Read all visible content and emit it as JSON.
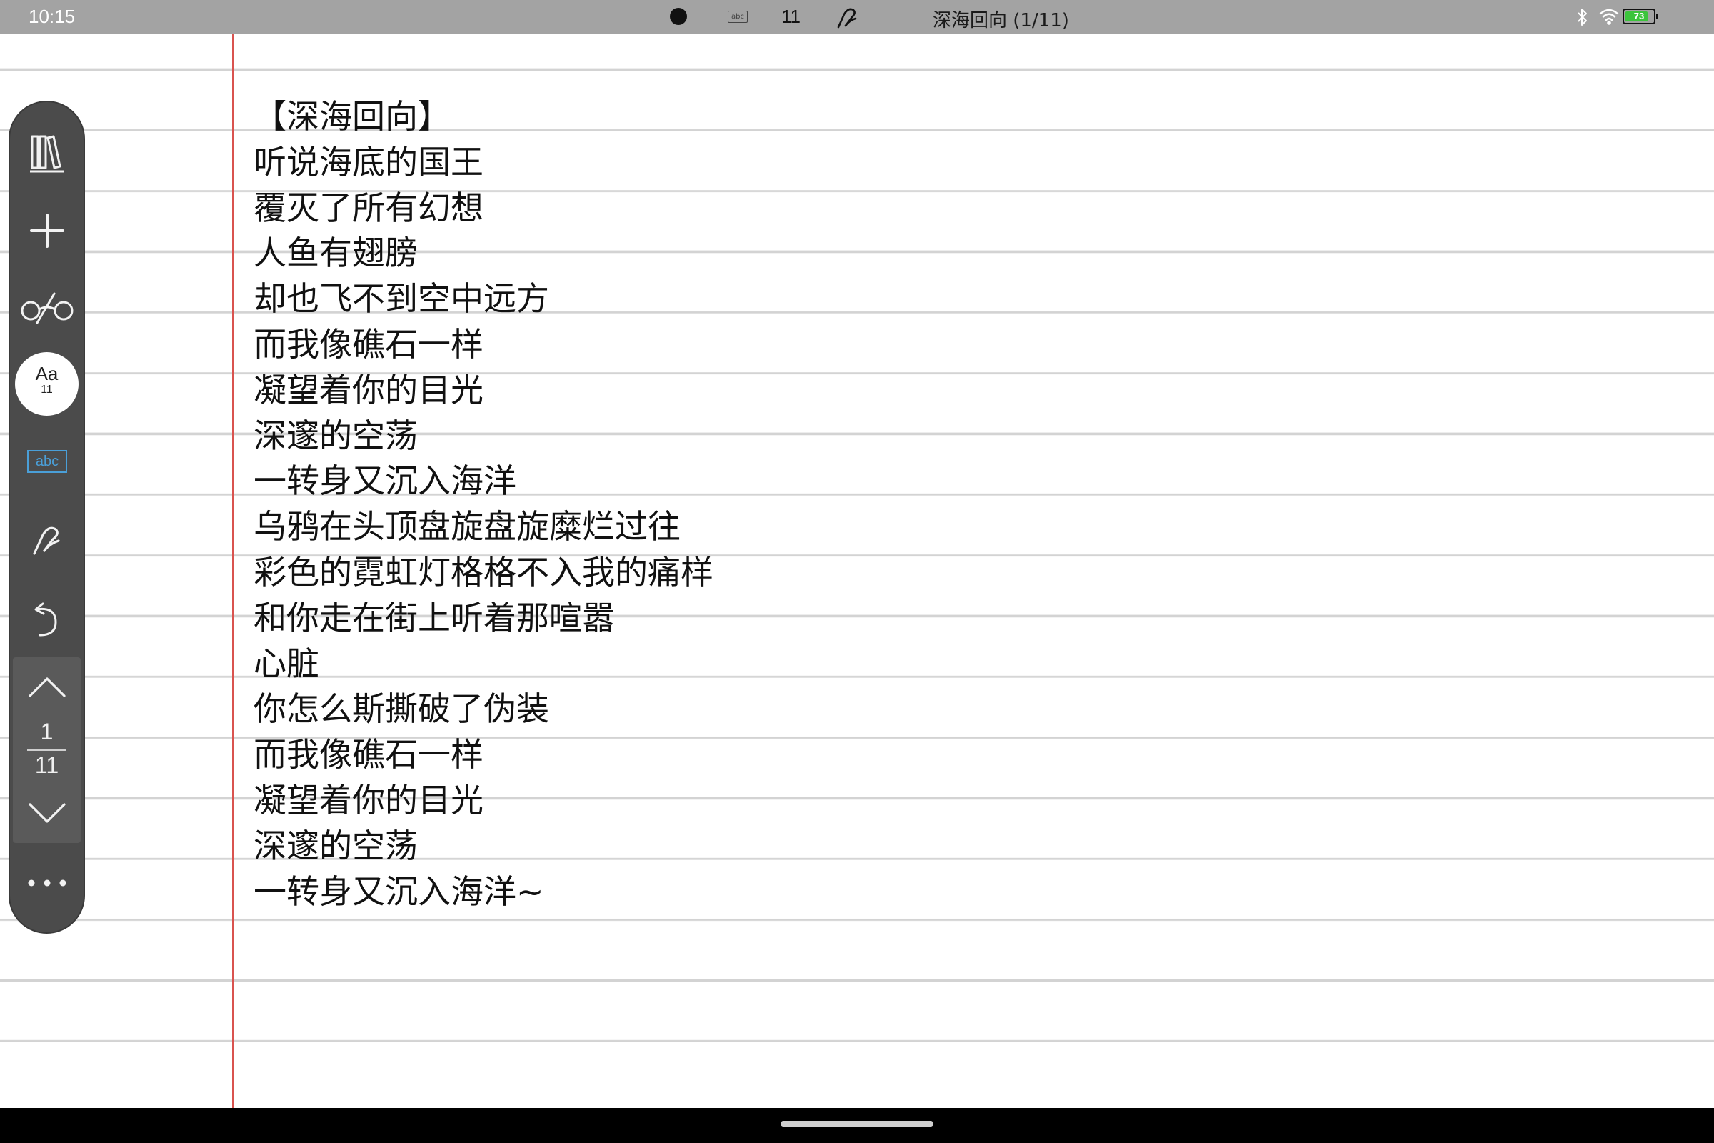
{
  "status_bar": {
    "time": "10:15",
    "abc_label": "abc",
    "page_count": "11",
    "title": "深海回向 (1/11)",
    "battery": "73"
  },
  "toolbar": {
    "font_label": "Aa",
    "font_size": "11",
    "text_mode_label": "abc",
    "page_current": "1",
    "page_total": "11"
  },
  "icons": {
    "library": "library-icon",
    "add": "plus-icon",
    "read_mode": "glasses-icon",
    "pen": "pen-icon",
    "undo": "undo-icon",
    "page_up": "chevron-up-icon",
    "page_down": "chevron-down-icon",
    "more": "more-dots-icon",
    "bluetooth": "bluetooth-icon",
    "wifi": "wifi-icon",
    "battery": "battery-icon"
  },
  "colors": {
    "status_bar": "#a3a3a3",
    "toolbar": "#4b4b4b",
    "accent": "#4a9fd8",
    "margin_line": "#d9534f",
    "battery_fill": "#3cc43c"
  },
  "document": {
    "lines": [
      "【深海回向】",
      "听说海底的国王",
      "覆灭了所有幻想",
      "人鱼有翅膀",
      "却也飞不到空中远方",
      "而我像礁石一样",
      "凝望着你的目光",
      "深邃的空荡",
      "一转身又沉入海洋",
      "乌鸦在头顶盘旋盘旋糜烂过往",
      "彩色的霓虹灯格格不入我的痛样",
      "和你走在街上听着那喧嚣",
      "心脏",
      "你怎么斯撕破了伪装",
      "而我像礁石一样",
      "凝望着你的目光",
      "深邃的空荡",
      "一转身又沉入海洋~"
    ]
  }
}
